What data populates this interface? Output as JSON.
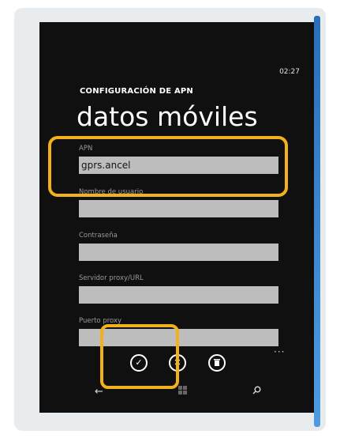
{
  "status": {
    "time": "02:27"
  },
  "header": {
    "subtitle": "CONFIGURACIÓN DE APN",
    "title": "datos móviles"
  },
  "fields": [
    {
      "label": "APN",
      "value": "gprs.ancel"
    },
    {
      "label": "Nombre de usuario",
      "value": ""
    },
    {
      "label": "Contraseña",
      "value": ""
    },
    {
      "label": "Servidor proxy/URL",
      "value": ""
    },
    {
      "label": "Puerto proxy",
      "value": ""
    }
  ],
  "appbar": {
    "more": "···",
    "icons": [
      "check-icon",
      "cancel-icon",
      "delete-icon"
    ]
  },
  "nav": {
    "icons": [
      "back-icon",
      "windows-icon",
      "search-icon"
    ]
  },
  "colors": {
    "highlight": "#f2b01c",
    "field_bg": "#bdbdbd",
    "screen_bg": "#101010"
  }
}
